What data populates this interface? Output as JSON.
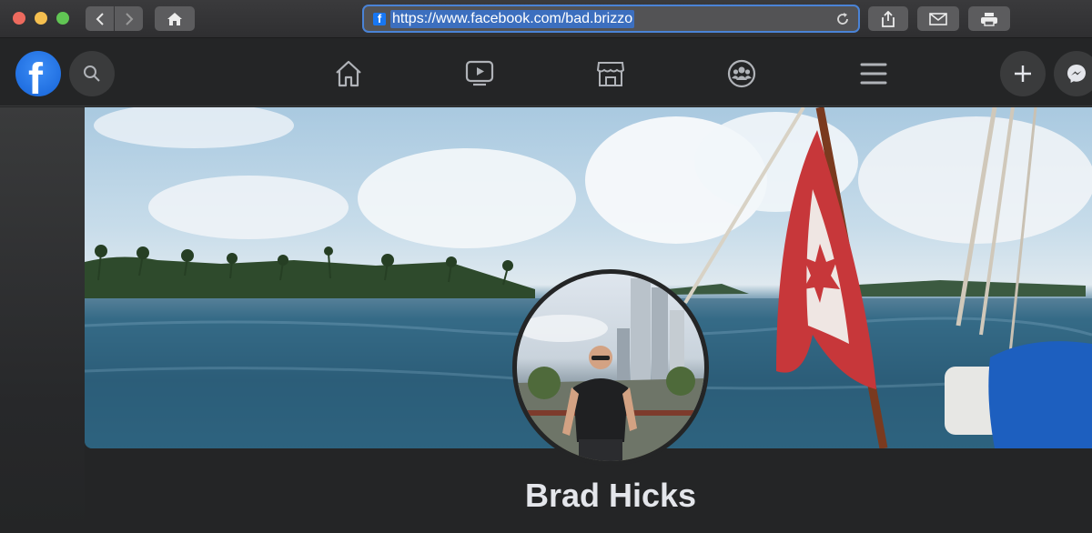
{
  "browser": {
    "url": "https://www.facebook.com/bad.brizzo",
    "favicon_letter": "f"
  },
  "facebook": {
    "logo_letter": "f",
    "nav_icons": [
      "home-icon",
      "watch-icon",
      "marketplace-icon",
      "groups-icon",
      "menu-icon"
    ],
    "actions": [
      "plus-icon",
      "messenger-icon"
    ],
    "brand_color": "#1877f2"
  },
  "profile": {
    "name": "Brad Hicks"
  }
}
